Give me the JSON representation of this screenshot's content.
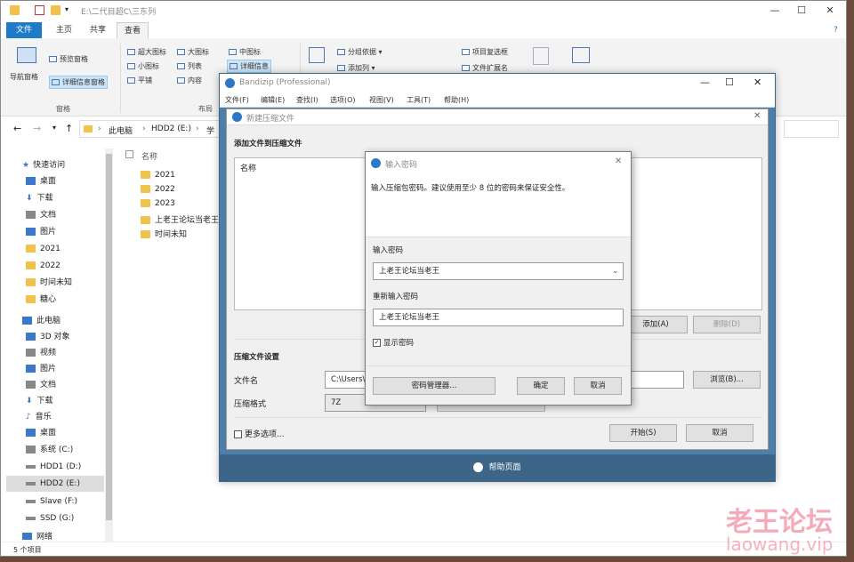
{
  "explorer": {
    "title": "E:\\二代目超C\\三东列",
    "tabs": [
      "文件",
      "主页",
      "共享",
      "查看"
    ],
    "ribbon": {
      "pane_items": [
        "导航窗格",
        "预览窗格",
        "详细信息窗格"
      ],
      "pane_group": "窗格",
      "layout_items": [
        "超大图标",
        "大图标",
        "中图标",
        "小图标",
        "列表",
        "详细信息",
        "平铺",
        "内容"
      ],
      "layout_group": "布局",
      "view_items": [
        "分组依据",
        "添加列",
        "项目复选框",
        "文件扩展名"
      ]
    },
    "address": [
      "此电脑",
      "HDD2 (E:)",
      "学"
    ],
    "nav": {
      "quick_access": "快速访问",
      "items": [
        "桌面",
        "下载",
        "文档",
        "图片",
        "2021",
        "2022",
        "时间未知",
        "糖心"
      ],
      "this_pc": "此电脑",
      "pc_items": [
        "3D 对象",
        "视频",
        "图片",
        "文档",
        "下载",
        "音乐",
        "桌面",
        "系统 (C:)",
        "HDD1 (D:)",
        "HDD2 (E:)",
        "Slave (F:)",
        "SSD (G:)"
      ],
      "network": "网络"
    },
    "column_name": "名称",
    "files": [
      "2021",
      "2022",
      "2023",
      "上老王论坛当老王",
      "时间未知"
    ],
    "status": "5 个项目"
  },
  "bandizip": {
    "title": "Bandizip (Professional)",
    "menu": [
      "文件(F)",
      "编辑(E)",
      "查找(I)",
      "选项(O)",
      "视图(V)",
      "工具(T)",
      "帮助(H)"
    ],
    "footer": "帮助页面"
  },
  "newarc": {
    "title": "新建压缩文件",
    "add_files": "添加文件到压缩文件",
    "col_name": "名称",
    "add_btn": "添加(A)",
    "del_btn": "删除(D)",
    "settings": "压缩文件设置",
    "filename_label": "文件名",
    "filename_value": "C:\\Users\\",
    "browse": "浏览(B)...",
    "format_label": "压缩格式",
    "format_value": "7Z",
    "more": "更多选项...",
    "start": "开始(S)",
    "cancel": "取消"
  },
  "pwd": {
    "title": "输入密码",
    "desc": "输入压缩包密码。建议使用至少 8 位的密码来保证安全性。",
    "label1": "输入密码",
    "value1": "上老王论坛当老王",
    "label2": "重新输入密码",
    "value2": "上老王论坛当老王",
    "show": "显示密码",
    "manager": "密码管理器...",
    "ok": "确定",
    "cancel": "取消"
  },
  "watermark": {
    "cn": "老王论坛",
    "en": "laowang.vip"
  }
}
